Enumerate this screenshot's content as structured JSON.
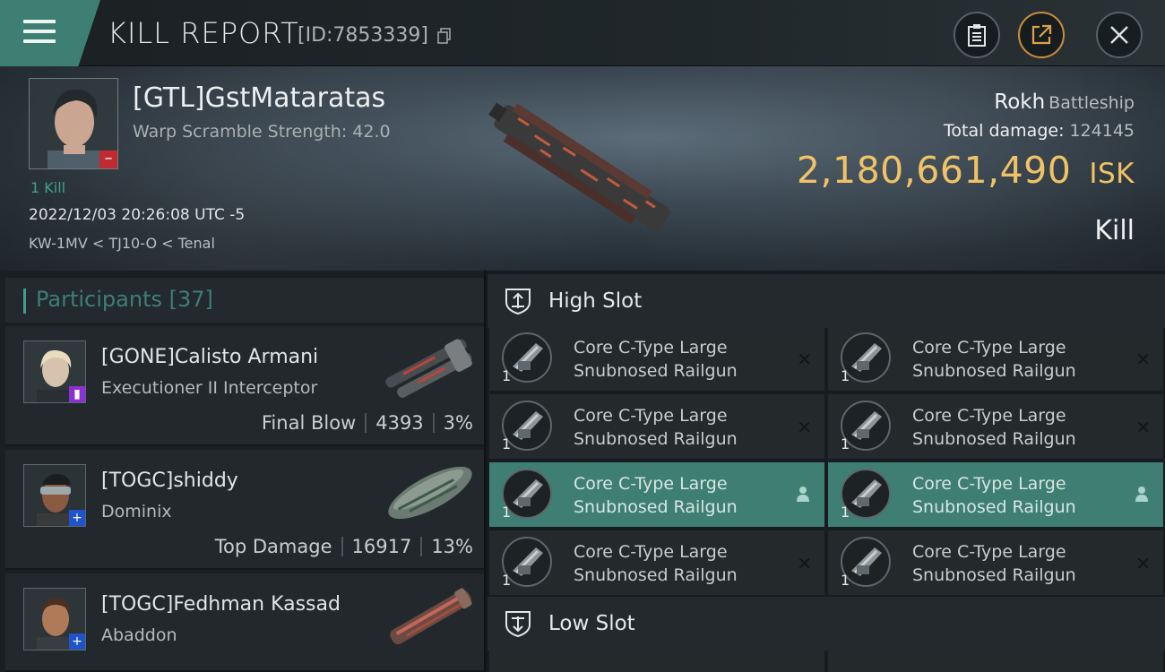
{
  "header": {
    "title": "KILL REPORT",
    "report_id": "[ID:7853339]"
  },
  "victim": {
    "name": "[GTL]GstMataratas",
    "warp_scramble": "Warp Scramble Strength: 42.0",
    "kills_label": "1 Kill",
    "datetime": "2022/12/03 20:26:08 UTC -5",
    "location": "KW-1MV < TJ10-O < Tenal",
    "ship_name": "Rokh",
    "ship_class": "Battleship",
    "total_damage_label": "Total damage:",
    "total_damage_value": "124145",
    "isk_value": "2,180,661,490",
    "isk_unit": "ISK",
    "result": "Kill"
  },
  "participants": {
    "label": "Participants",
    "count": "[37]",
    "items": [
      {
        "name": "[GONE]Calisto Armani",
        "ship": "Executioner II Interceptor",
        "stat_label": "Final Blow",
        "damage": "4393",
        "percent": "3%"
      },
      {
        "name": "[TOGC]shiddy",
        "ship": "Dominix",
        "stat_label": "Top Damage",
        "damage": "16917",
        "percent": "13%"
      },
      {
        "name": "[TOGC]Fedhman Kassad",
        "ship": "Abaddon"
      }
    ]
  },
  "slots": {
    "high_label": "High Slot",
    "low_label": "Low Slot",
    "high_modules": [
      {
        "line1": "Core C-Type Large",
        "line2": "Snubnosed Railgun",
        "qty": "1",
        "status": "destroyed"
      },
      {
        "line1": "Core C-Type Large",
        "line2": "Snubnosed Railgun",
        "qty": "1",
        "status": "destroyed"
      },
      {
        "line1": "Core C-Type Large",
        "line2": "Snubnosed Railgun",
        "qty": "1",
        "status": "destroyed"
      },
      {
        "line1": "Core C-Type Large",
        "line2": "Snubnosed Railgun",
        "qty": "1",
        "status": "destroyed"
      },
      {
        "line1": "Core C-Type Large",
        "line2": "Snubnosed Railgun",
        "qty": "1",
        "status": "dropped"
      },
      {
        "line1": "Core C-Type Large",
        "line2": "Snubnosed Railgun",
        "qty": "1",
        "status": "dropped"
      },
      {
        "line1": "Core C-Type Large",
        "line2": "Snubnosed Railgun",
        "qty": "1",
        "status": "destroyed"
      },
      {
        "line1": "Core C-Type Large",
        "line2": "Snubnosed Railgun",
        "qty": "1",
        "status": "destroyed"
      }
    ]
  },
  "colors": {
    "accent": "#3f7f73",
    "isk": "#f0c266",
    "kill_badge": "#c0222a",
    "participant_badge_1": "#8b2fd6",
    "participant_badge_2": "#1f53c9"
  }
}
